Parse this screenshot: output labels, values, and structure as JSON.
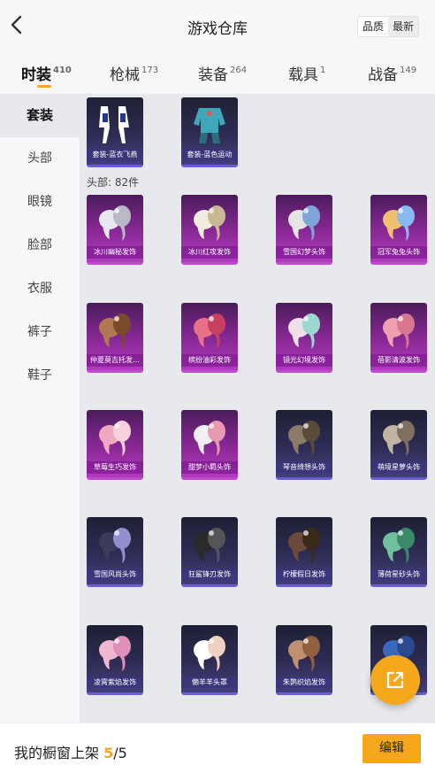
{
  "header": {
    "title": "游戏仓库",
    "sort_options": [
      "品质",
      "最新"
    ],
    "selected_sort": "品质"
  },
  "tabs": [
    {
      "label": "时装",
      "count": "410"
    },
    {
      "label": "枪械",
      "count": "173"
    },
    {
      "label": "装备",
      "count": "264"
    },
    {
      "label": "载具",
      "count": "1"
    },
    {
      "label": "战备",
      "count": "149"
    }
  ],
  "active_tab": "时装",
  "sidebar": {
    "items": [
      "套装",
      "头部",
      "眼镜",
      "脸部",
      "衣服",
      "裤子",
      "鞋子"
    ],
    "active": "套装"
  },
  "sets": [
    {
      "name": "套装-蓝衣飞燕",
      "rarity": "blue"
    },
    {
      "name": "套装-蓝色运动",
      "rarity": "blue"
    }
  ],
  "head_section": {
    "label": "头部: 82件",
    "items": [
      {
        "name": "冰川幽秘发饰",
        "rarity": "purple"
      },
      {
        "name": "冰川红攻发饰",
        "rarity": "purple"
      },
      {
        "name": "雪国幻梦头饰",
        "rarity": "purple"
      },
      {
        "name": "冠军兔兔头饰",
        "rarity": "purple"
      },
      {
        "name": "仲夏莫吉托发…",
        "rarity": "purple"
      },
      {
        "name": "缤纷油彩发饰",
        "rarity": "purple"
      },
      {
        "name": "镜光幻境发饰",
        "rarity": "purple"
      },
      {
        "name": "蓓影清波发饰",
        "rarity": "purple"
      },
      {
        "name": "草莓生巧发饰",
        "rarity": "purple"
      },
      {
        "name": "甜梦小羁头饰",
        "rarity": "purple"
      },
      {
        "name": "琴音绮想头饰",
        "rarity": "blue"
      },
      {
        "name": "萌境星萝头饰",
        "rarity": "blue"
      },
      {
        "name": "雪国风尚头饰",
        "rarity": "blue"
      },
      {
        "name": "狂鲨锋刃发饰",
        "rarity": "blue"
      },
      {
        "name": "柠檬假日发饰",
        "rarity": "blue"
      },
      {
        "name": "薄荷星砂头饰",
        "rarity": "blue"
      },
      {
        "name": "凌霄紫焰发饰",
        "rarity": "blue"
      },
      {
        "name": "懒羊羊头罩",
        "rarity": "blue"
      },
      {
        "name": "朱鹮织焰发饰",
        "rarity": "blue"
      },
      {
        "name": "",
        "rarity": "blue"
      }
    ]
  },
  "bottom_bar": {
    "shelf_label": "我的橱窗上架",
    "shelf_current": "5",
    "shelf_total": "/5",
    "edit_label": "编辑"
  },
  "colors": {
    "accent": "#f5a623",
    "purple_card": "#8a2896",
    "blue_card": "#2e2c54"
  }
}
